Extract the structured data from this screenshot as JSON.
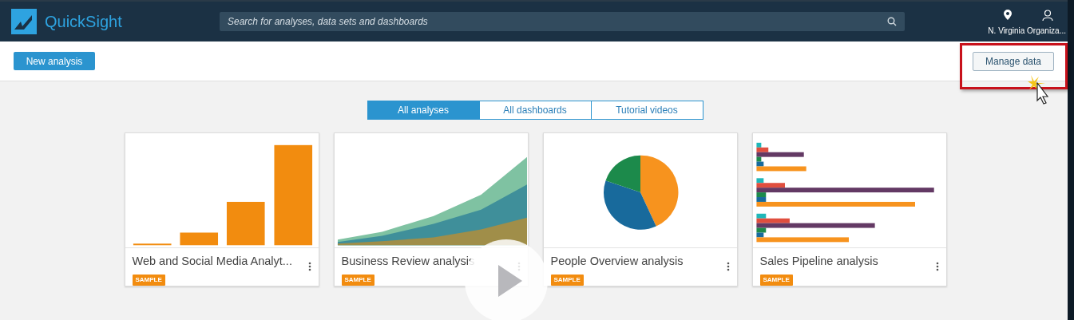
{
  "header": {
    "app_name": "QuickSight",
    "search": {
      "placeholder": "Search for analyses, data sets and dashboards"
    },
    "region_label": "N. Virginia Organiza..."
  },
  "toolbar": {
    "new_button": "New analysis",
    "manage_button": "Manage data"
  },
  "tabs": [
    {
      "label": "All analyses",
      "selected": true
    },
    {
      "label": "All dashboards",
      "selected": false
    },
    {
      "label": "Tutorial videos",
      "selected": false
    }
  ],
  "cards": [
    {
      "title": "Web and Social Media Analyt...",
      "badge": "SAMPLE",
      "kind": "bar"
    },
    {
      "title": "Business Review analysis",
      "badge": "SAMPLE",
      "kind": "area"
    },
    {
      "title": "People Overview analysis",
      "badge": "SAMPLE",
      "kind": "pie"
    },
    {
      "title": "Sales Pipeline analysis",
      "badge": "SAMPLE",
      "kind": "hbar"
    }
  ]
}
